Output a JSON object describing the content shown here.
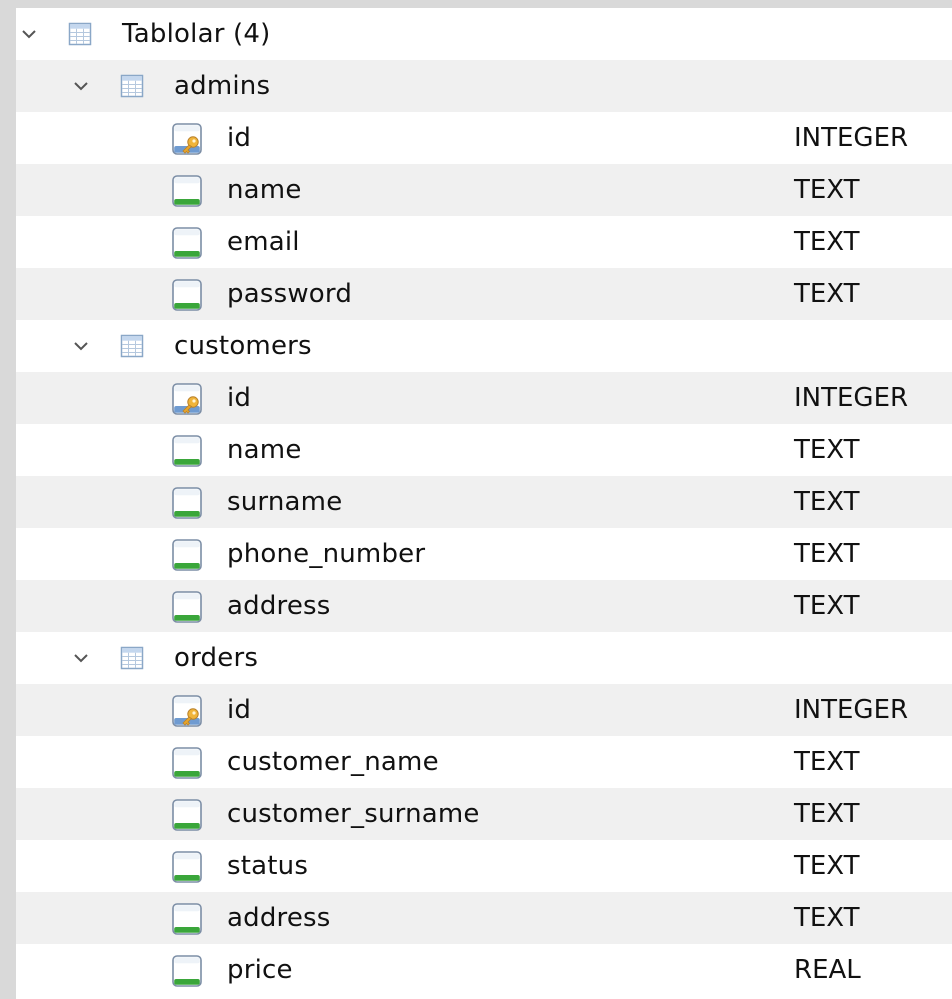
{
  "tree": {
    "root": {
      "label": "Tablolar (4)"
    },
    "tables": [
      {
        "name": "admins",
        "columns": [
          {
            "name": "id",
            "type": "INTEGER",
            "key": true
          },
          {
            "name": "name",
            "type": "TEXT",
            "key": false
          },
          {
            "name": "email",
            "type": "TEXT",
            "key": false
          },
          {
            "name": "password",
            "type": "TEXT",
            "key": false
          }
        ]
      },
      {
        "name": "customers",
        "columns": [
          {
            "name": "id",
            "type": "INTEGER",
            "key": true
          },
          {
            "name": "name",
            "type": "TEXT",
            "key": false
          },
          {
            "name": "surname",
            "type": "TEXT",
            "key": false
          },
          {
            "name": "phone_number",
            "type": "TEXT",
            "key": false
          },
          {
            "name": "address",
            "type": "TEXT",
            "key": false
          }
        ]
      },
      {
        "name": "orders",
        "columns": [
          {
            "name": "id",
            "type": "INTEGER",
            "key": true
          },
          {
            "name": "customer_name",
            "type": "TEXT",
            "key": false
          },
          {
            "name": "customer_surname",
            "type": "TEXT",
            "key": false
          },
          {
            "name": "status",
            "type": "TEXT",
            "key": false
          },
          {
            "name": "address",
            "type": "TEXT",
            "key": false
          },
          {
            "name": "price",
            "type": "REAL",
            "key": false
          }
        ]
      }
    ]
  },
  "icons": {
    "expand": "chevron-down-icon",
    "table": "table-icon",
    "column": "column-icon",
    "key_column": "primary-key-column-icon"
  },
  "colors": {
    "background": "#d9d9d9",
    "panel": "#ffffff",
    "stripe": "#f0f0f0",
    "column_icon_bar": "#3aa63a",
    "key_icon": "#e8a52a"
  }
}
